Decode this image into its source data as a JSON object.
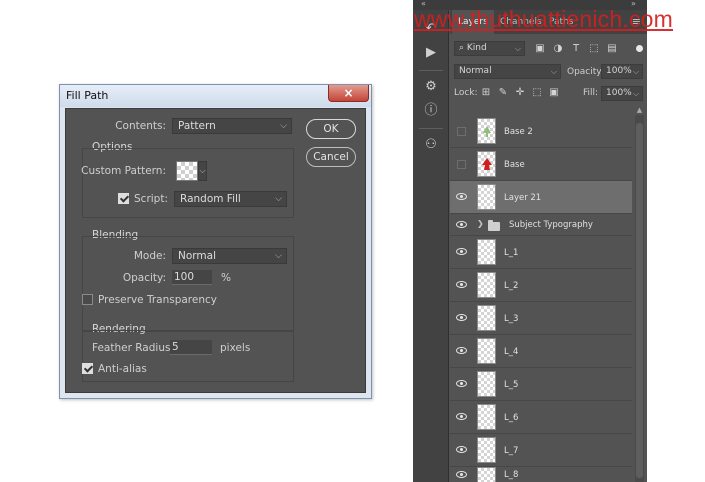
{
  "dialog": {
    "title": "Fill Path",
    "close_glyph": "×",
    "contents_label": "Contents:",
    "contents_value": "Pattern",
    "options_title": "Options",
    "custom_pattern_label": "Custom Pattern:",
    "script_label": "Script:",
    "script_checked": true,
    "script_value": "Random Fill",
    "blending_title": "Blending",
    "mode_label": "Mode:",
    "mode_value": "Normal",
    "opacity_label": "Opacity:",
    "opacity_value": "100",
    "opacity_unit": "%",
    "preserve_label": "Preserve Transparency",
    "preserve_checked": false,
    "rendering_title": "Rendering",
    "feather_label": "Feather Radius:",
    "feather_value": "5",
    "feather_unit": "pixels",
    "antialias_label": "Anti-alias",
    "antialias_checked": true,
    "ok_label": "OK",
    "cancel_label": "Cancel"
  },
  "panel": {
    "collapse_left": "«",
    "collapse_right": "»",
    "tabs": [
      {
        "label": "Layers",
        "active": true
      },
      {
        "label": "Channels",
        "active": false
      },
      {
        "label": "Paths",
        "active": false
      }
    ],
    "menu_icon": "≡",
    "filter_kind": "⌕ Kind",
    "blend_mode": "Normal",
    "opacity_label": "Opacity:",
    "opacity_value": "100%",
    "lock_label": "Lock:",
    "fill_label": "Fill:",
    "fill_value": "100%",
    "layers": [
      {
        "name": "Base 2",
        "visible": false,
        "selected": false,
        "type": "layer",
        "thumb": "green"
      },
      {
        "name": "Base",
        "visible": false,
        "selected": false,
        "type": "layer",
        "thumb": "red"
      },
      {
        "name": "Layer 21",
        "visible": true,
        "selected": true,
        "type": "layer",
        "thumb": "empty"
      },
      {
        "name": "Subject Typography",
        "visible": true,
        "selected": false,
        "type": "group",
        "thumb": "none"
      },
      {
        "name": "L_1",
        "visible": true,
        "selected": false,
        "type": "layer",
        "thumb": "empty"
      },
      {
        "name": "L_2",
        "visible": true,
        "selected": false,
        "type": "layer",
        "thumb": "empty"
      },
      {
        "name": "L_3",
        "visible": true,
        "selected": false,
        "type": "layer",
        "thumb": "empty"
      },
      {
        "name": "L_4",
        "visible": true,
        "selected": false,
        "type": "layer",
        "thumb": "empty"
      },
      {
        "name": "L_5",
        "visible": true,
        "selected": false,
        "type": "layer",
        "thumb": "empty"
      },
      {
        "name": "L_6",
        "visible": true,
        "selected": false,
        "type": "layer",
        "thumb": "empty"
      },
      {
        "name": "L_7",
        "visible": true,
        "selected": false,
        "type": "layer",
        "thumb": "empty"
      },
      {
        "name": "L_8",
        "visible": true,
        "selected": false,
        "type": "layer",
        "thumb": "empty"
      }
    ]
  },
  "watermark": "www.thuthuattienich.com",
  "colors": {
    "dialog_client": "#535353",
    "panel_bg": "#535353",
    "selected_row": "#6e6e6e",
    "watermark": "#d41f1f"
  }
}
